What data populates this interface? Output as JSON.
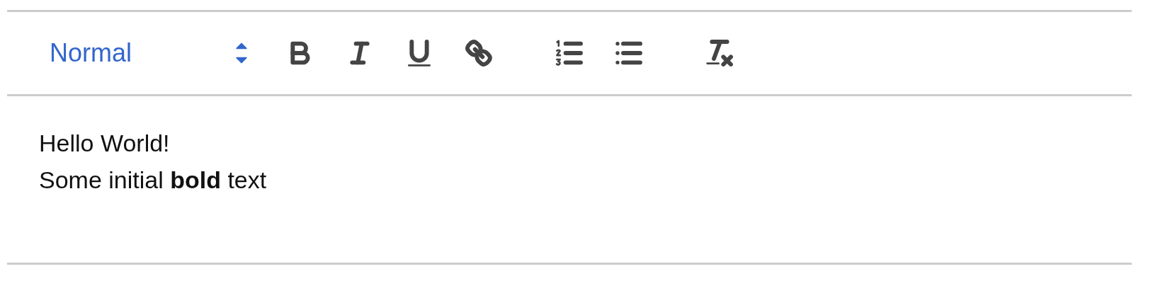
{
  "toolbar": {
    "header_select": {
      "value": "Normal"
    },
    "groups": [
      {
        "buttons": [
          {
            "kind": "bold"
          },
          {
            "kind": "italic"
          },
          {
            "kind": "underline"
          },
          {
            "kind": "link"
          }
        ]
      },
      {
        "buttons": [
          {
            "kind": "ordered_list"
          },
          {
            "kind": "bullet_list"
          }
        ]
      },
      {
        "buttons": [
          {
            "kind": "clean"
          }
        ]
      }
    ]
  },
  "editor": {
    "lines": [
      "Hello World!",
      "Some initial **bold** text"
    ]
  }
}
